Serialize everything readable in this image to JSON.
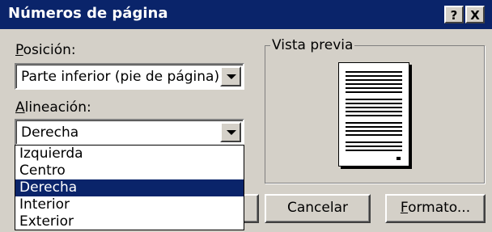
{
  "dialog": {
    "title": "Números de página",
    "help_button": "?",
    "close_button": "X"
  },
  "position": {
    "label_underlined": "P",
    "label_rest": "osición:",
    "value": "Parte inferior (pie de página)"
  },
  "alignment": {
    "label_underlined": "A",
    "label_rest": "lineación:",
    "value": "Derecha",
    "options": [
      "Izquierda",
      "Centro",
      "Derecha",
      "Interior",
      "Exterior"
    ],
    "selected_index": 2
  },
  "preview": {
    "label": "Vista previa"
  },
  "buttons": {
    "cancel": "Cancelar",
    "format_underlined": "F",
    "format_rest": "ormato..."
  }
}
